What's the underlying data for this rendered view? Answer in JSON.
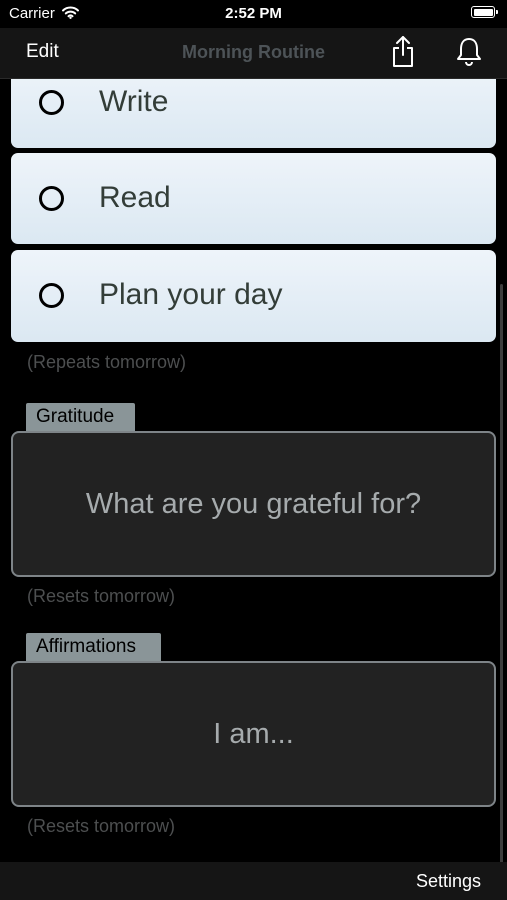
{
  "status_bar": {
    "carrier": "Carrier",
    "time": "2:52 PM"
  },
  "nav": {
    "edit_label": "Edit",
    "title": "Morning Routine",
    "share_icon": "share-icon",
    "bell_icon": "bell-icon"
  },
  "tasks": [
    {
      "label": "Write",
      "checked": false
    },
    {
      "label": "Read",
      "checked": false
    },
    {
      "label": "Plan your day",
      "checked": false
    }
  ],
  "tasks_note": "(Repeats tomorrow)",
  "gratitude": {
    "tab": "Gratitude",
    "placeholder": "What are you grateful for?",
    "note": "(Resets tomorrow)"
  },
  "affirmations": {
    "tab": "Affirmations",
    "placeholder": "I am...",
    "note": "(Resets tomorrow)"
  },
  "toolbar": {
    "settings_label": "Settings"
  },
  "colors": {
    "background": "#000000",
    "card": "#e4eef6",
    "card_text": "#333d38",
    "tab": "#8a9598",
    "box_bg": "#222222",
    "muted": "#4d4f50"
  }
}
